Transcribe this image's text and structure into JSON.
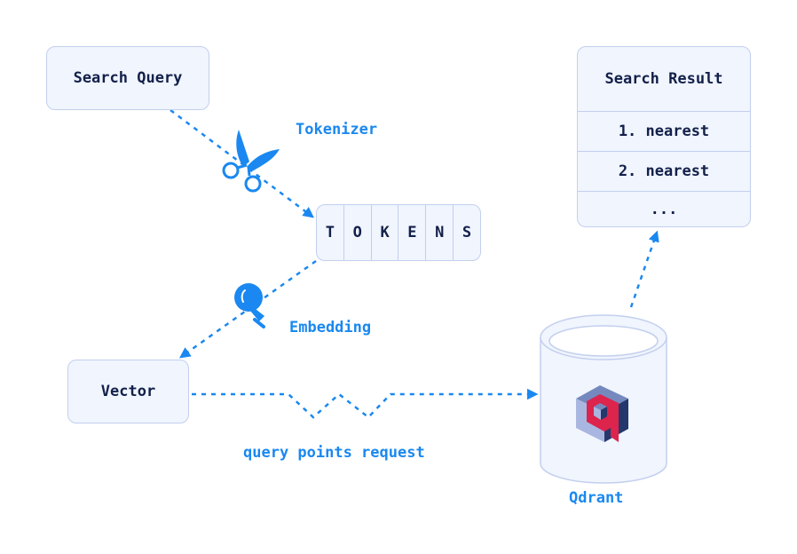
{
  "nodes": {
    "search_query": "Search Query",
    "vector": "Vector",
    "tokens": [
      "T",
      "O",
      "K",
      "E",
      "N",
      "S"
    ],
    "search_result": {
      "title": "Search Result",
      "items": [
        "1. nearest",
        "2. nearest",
        "..."
      ]
    },
    "qdrant": "Qdrant"
  },
  "edges": {
    "tokenizer": "Tokenizer",
    "embedding": "Embedding",
    "request": "query points request"
  },
  "icons": {
    "tokenizer": "scissors-icon",
    "embedding": "lightbulb-icon",
    "database": "qdrant-logo-icon"
  },
  "colors": {
    "accent": "#1a88f0",
    "node_fill": "#f0f5fe",
    "node_border": "#c3cfee",
    "text": "#13204a",
    "logo_red": "#dc244c",
    "logo_dark": "#24386c",
    "logo_mid": "#7589be",
    "logo_light": "#a9b7e0"
  }
}
